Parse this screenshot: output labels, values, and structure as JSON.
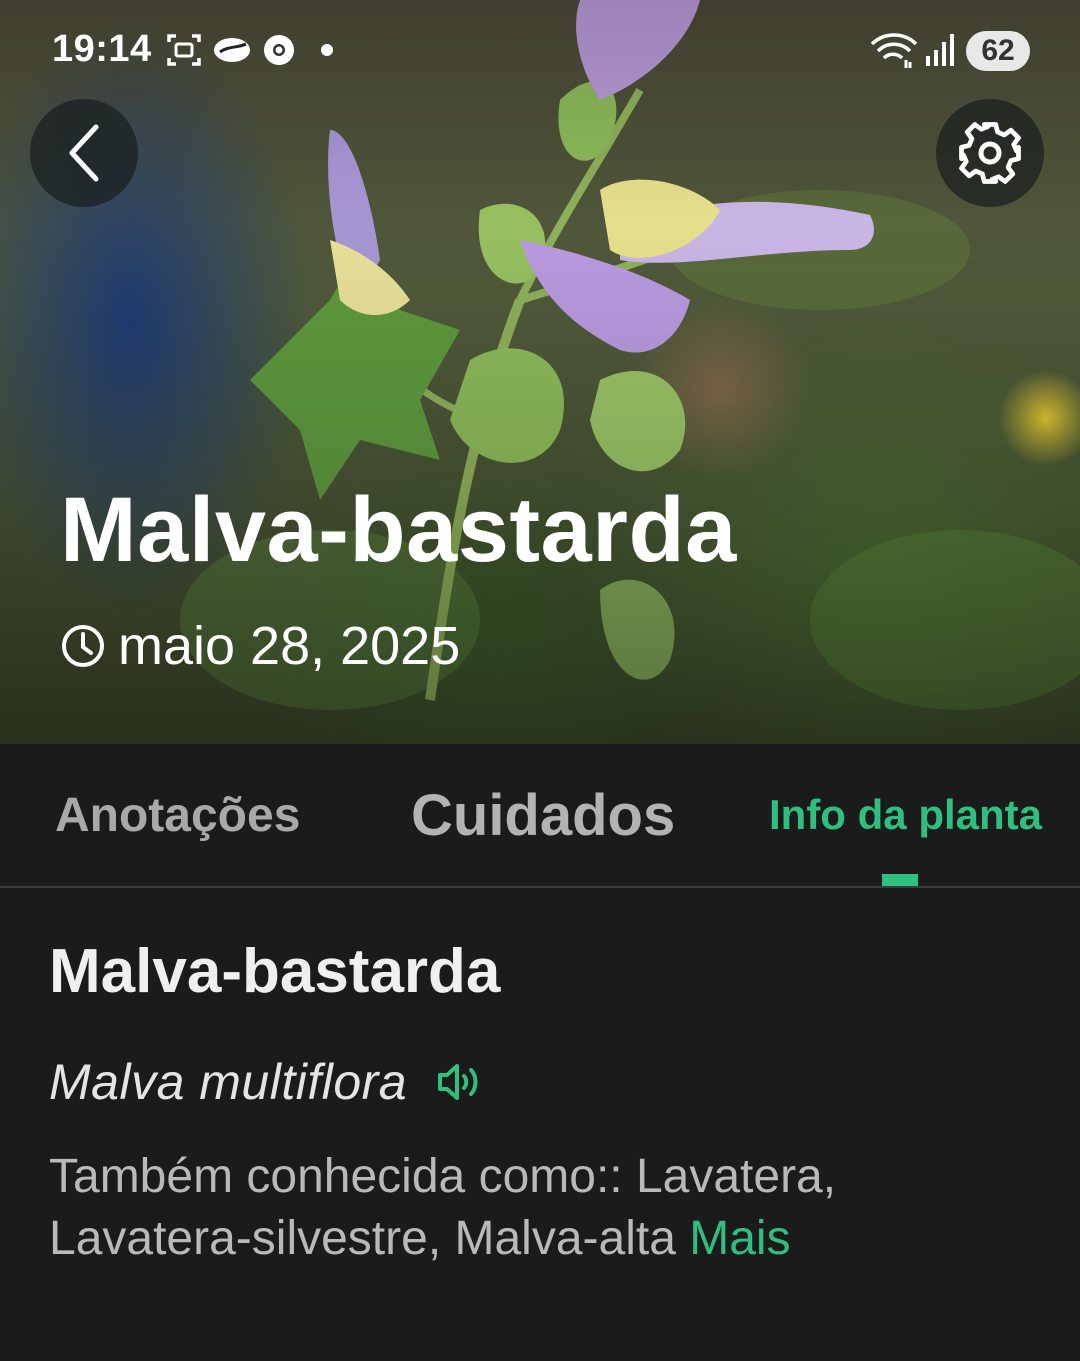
{
  "status_bar": {
    "time": "19:14",
    "battery": "62",
    "icons": [
      "screenshot-icon",
      "cloud-icon",
      "chrome-icon",
      "dot-icon",
      "wifi-icon",
      "signal-icon"
    ]
  },
  "header": {
    "back_icon": "chevron-left-icon",
    "settings_icon": "gear-icon"
  },
  "hero": {
    "title": "Malva-bastarda",
    "date": "maio 28, 2025",
    "date_icon": "clock-icon"
  },
  "tabs": [
    {
      "label": "Anotações",
      "active": false
    },
    {
      "label": "Cuidados",
      "active": false
    },
    {
      "label": "Info da planta",
      "active": true
    }
  ],
  "info": {
    "common_name": "Malva-bastarda",
    "scientific_name": "Malva multiflora",
    "speaker_icon": "speaker-icon",
    "also_known_as": "Também conhecida como:: Lavatera, Lavatera-silvestre, Malva-alta",
    "more_label": "Mais"
  },
  "colors": {
    "accent": "#2fbf7f",
    "background": "#1b1b1b",
    "tab_inactive": "#a9a9a9"
  }
}
